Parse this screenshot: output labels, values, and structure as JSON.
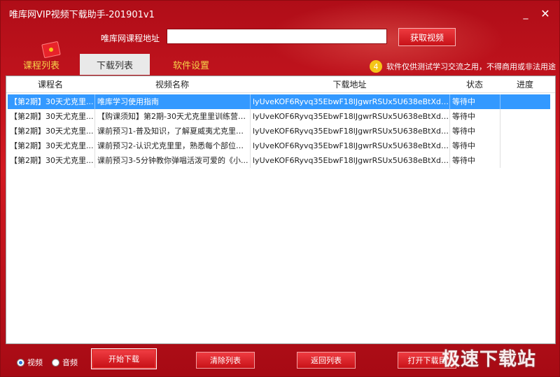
{
  "window": {
    "title": "唯库网VIP视频下载助手-201901v1"
  },
  "controls": {
    "minimize": "_",
    "close": "✕"
  },
  "url_bar": {
    "label": "唯库网课程地址",
    "value": "",
    "fetch_label": "获取视频"
  },
  "tabs": [
    {
      "label": "课程列表",
      "active": false
    },
    {
      "label": "下载列表",
      "active": true
    },
    {
      "label": "软件设置",
      "active": false
    }
  ],
  "notice": {
    "icon": "4",
    "text": "软件仅供测试学习交流之用，不得商用或非法用途"
  },
  "table": {
    "headers": {
      "course": "课程名",
      "video": "视频名称",
      "url": "下载地址",
      "status": "状态",
      "progress": "进度"
    },
    "rows": [
      {
        "course": "【第2期】30天尤克里...",
        "video": "唯库学习使用指南",
        "url": "lyUveKOF6Ryvq35EbwF18lJgwrRSUx5U638eBtXdvu3...",
        "status": "等待中",
        "progress": ""
      },
      {
        "course": "【第2期】30天尤克里...",
        "video": "【购课须知】第2期-30天尤克里里训练营，...",
        "url": "lyUveKOF6Ryvq35EbwF18lJgwrRSUx5U638eBtXdvu3...",
        "status": "等待中",
        "progress": ""
      },
      {
        "course": "【第2期】30天尤克里...",
        "video": "课前预习1-普及知识，了解夏威夷尤克里里...",
        "url": "lyUveKOF6Ryvq35EbwF18lJgwrRSUx5U638eBtXdvu3...",
        "status": "等待中",
        "progress": ""
      },
      {
        "course": "【第2期】30天尤克里...",
        "video": "课前预习2-认识尤克里里，熟悉每个部位的...",
        "url": "lyUveKOF6Ryvq35EbwF18lJgwrRSUx5U638eBtXdvu3...",
        "status": "等待中",
        "progress": ""
      },
      {
        "course": "【第2期】30天尤克里...",
        "video": "课前预习3-5分钟教你弹唱活泼可爱的《小...",
        "url": "lyUveKOF6Ryvq35EbwF18lJgwrRSUx5U638eBtXdvu3...",
        "status": "等待中",
        "progress": ""
      }
    ]
  },
  "media_type": {
    "video_label": "视频",
    "audio_label": "音频",
    "selected": "video"
  },
  "actions": {
    "start": "开始下载",
    "clear": "清除列表",
    "back": "返回列表",
    "open": "打开下载目"
  },
  "watermark": "极速下载站"
}
